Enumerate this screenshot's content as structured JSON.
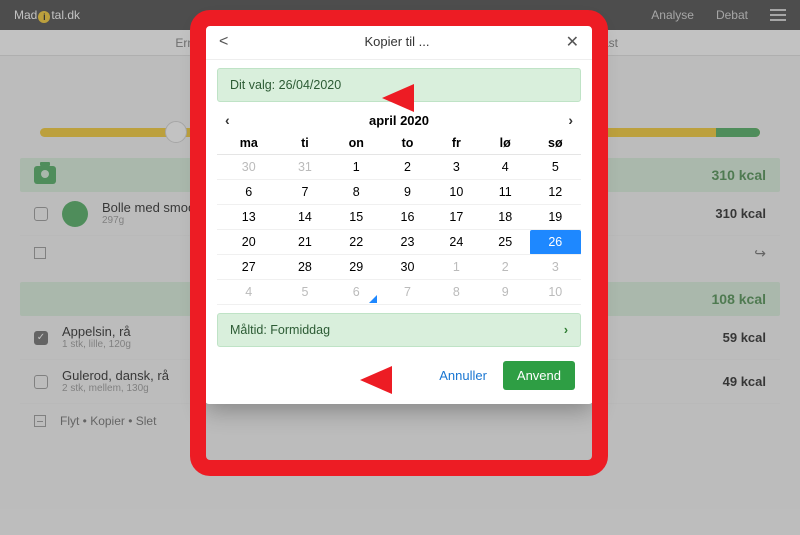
{
  "topbar": {
    "brand_left": "Mad",
    "brand_right": "tal.dk",
    "nav": {
      "analyse": "Analyse",
      "debat": "Debat"
    }
  },
  "subtabs": {
    "left": "Ernæring",
    "right": "Indtast"
  },
  "meals": [
    {
      "kcal": "310 kcal",
      "foods": [
        {
          "name": "Bolle med smooth",
          "detail": "297g",
          "kcal": "310 kcal",
          "checked": false,
          "dot": true
        }
      ],
      "action_row": {
        "type": "square_share"
      }
    },
    {
      "kcal": "108 kcal",
      "foods": [
        {
          "name": "Appelsin, rå",
          "detail": "1 stk, lille, 120g",
          "kcal": "59 kcal",
          "checked": true,
          "dot": false
        },
        {
          "name": "Gulerod, dansk, rå",
          "detail": "2 stk, mellem, 130g",
          "kcal": "49 kcal",
          "checked": false,
          "dot": false
        }
      ],
      "action_row": {
        "type": "minus",
        "text": "Flyt • Kopier • Slet"
      }
    }
  ],
  "modal": {
    "title": "Kopier til ...",
    "selection_label": "Dit valg: 26/04/2020",
    "month_label": "april 2020",
    "weekdays": [
      "ma",
      "ti",
      "on",
      "to",
      "fr",
      "lø",
      "sø"
    ],
    "weeks": [
      [
        {
          "d": "30",
          "dim": true
        },
        {
          "d": "31",
          "dim": true
        },
        {
          "d": "1"
        },
        {
          "d": "2"
        },
        {
          "d": "3"
        },
        {
          "d": "4"
        },
        {
          "d": "5"
        }
      ],
      [
        {
          "d": "6"
        },
        {
          "d": "7"
        },
        {
          "d": "8"
        },
        {
          "d": "9"
        },
        {
          "d": "10"
        },
        {
          "d": "11"
        },
        {
          "d": "12"
        }
      ],
      [
        {
          "d": "13"
        },
        {
          "d": "14"
        },
        {
          "d": "15"
        },
        {
          "d": "16"
        },
        {
          "d": "17"
        },
        {
          "d": "18"
        },
        {
          "d": "19"
        }
      ],
      [
        {
          "d": "20"
        },
        {
          "d": "21"
        },
        {
          "d": "22"
        },
        {
          "d": "23"
        },
        {
          "d": "24"
        },
        {
          "d": "25"
        },
        {
          "d": "26",
          "sel": true
        }
      ],
      [
        {
          "d": "27"
        },
        {
          "d": "28"
        },
        {
          "d": "29"
        },
        {
          "d": "30"
        },
        {
          "d": "1",
          "dim": true
        },
        {
          "d": "2",
          "dim": true
        },
        {
          "d": "3",
          "dim": true
        }
      ],
      [
        {
          "d": "4",
          "dim": true
        },
        {
          "d": "5",
          "dim": true
        },
        {
          "d": "6",
          "dim": true,
          "today": true
        },
        {
          "d": "7",
          "dim": true
        },
        {
          "d": "8",
          "dim": true
        },
        {
          "d": "9",
          "dim": true
        },
        {
          "d": "10",
          "dim": true
        }
      ]
    ],
    "meal_label": "Måltid: Formiddag",
    "cancel": "Annuller",
    "apply": "Anvend"
  }
}
